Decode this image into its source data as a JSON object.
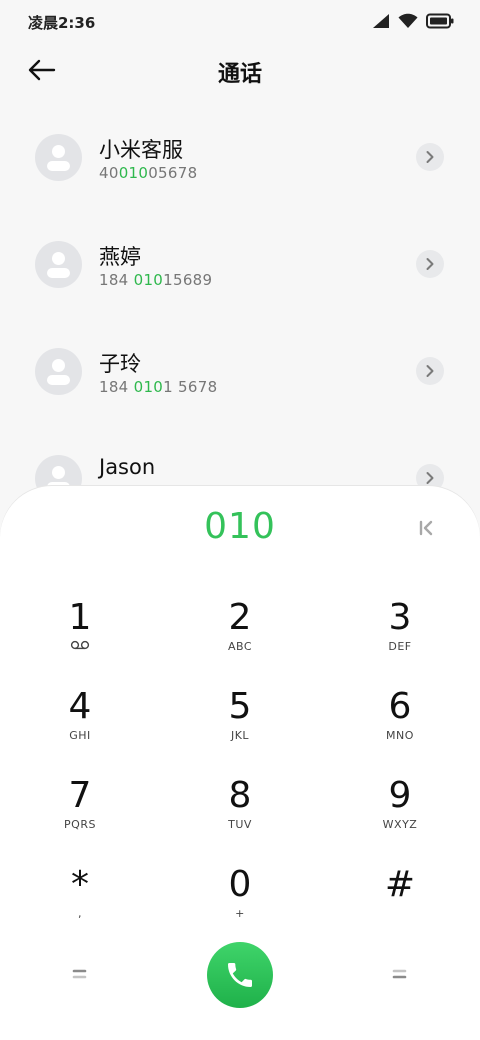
{
  "status": {
    "time": "凌晨2:36"
  },
  "header": {
    "title": "通话"
  },
  "contacts": [
    {
      "name": "小米客服",
      "num_pre": "40",
      "num_hl": "010",
      "num_post": "05678"
    },
    {
      "name": "燕婷",
      "num_pre": "184 ",
      "num_hl": "010",
      "num_post": "15689"
    },
    {
      "name": "子玲",
      "num_pre": "184 ",
      "num_hl": "010",
      "num_post": "1 5678"
    },
    {
      "name": "Jason",
      "num_pre": "",
      "num_hl": "",
      "num_post": ""
    }
  ],
  "dialpad": {
    "dialed": "010",
    "keys": [
      {
        "digit": "1",
        "letters": "voicemail-icon"
      },
      {
        "digit": "2",
        "letters": "ABC"
      },
      {
        "digit": "3",
        "letters": "DEF"
      },
      {
        "digit": "4",
        "letters": "GHI"
      },
      {
        "digit": "5",
        "letters": "JKL"
      },
      {
        "digit": "6",
        "letters": "MNO"
      },
      {
        "digit": "7",
        "letters": "PQRS"
      },
      {
        "digit": "8",
        "letters": "TUV"
      },
      {
        "digit": "9",
        "letters": "WXYZ"
      },
      {
        "digit": "*",
        "letters": ","
      },
      {
        "digit": "0",
        "letters": "+"
      },
      {
        "digit": "#",
        "letters": ""
      }
    ]
  },
  "colors": {
    "accent": "#34c25a",
    "call": "#27c155",
    "background": "#f7f7f7"
  },
  "icons": [
    "back-arrow-icon",
    "signal-icon",
    "wifi-icon",
    "battery-icon",
    "chevron-right-icon",
    "backspace-icon",
    "phone-icon",
    "sim-icon"
  ]
}
